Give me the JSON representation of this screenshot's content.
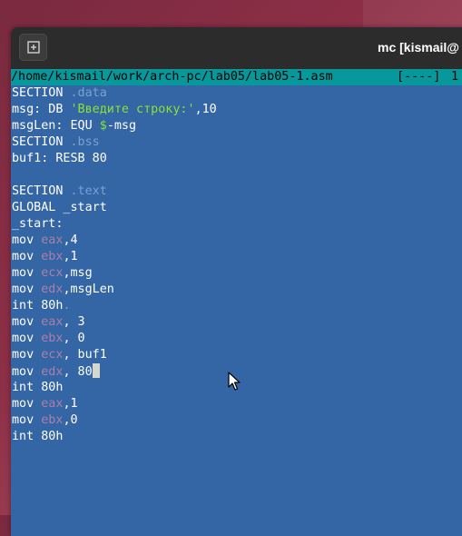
{
  "window": {
    "title": "mc [kismail@"
  },
  "statusbar": {
    "path": "/home/kismail/work/arch-pc/lab05/lab05-1.asm",
    "flags": "[----]",
    "col": "1"
  },
  "code": {
    "l1_kw": "SECTION ",
    "l1_sec": ".data",
    "l2_a": "msg: DB ",
    "l2_str": "'Введите строку:'",
    "l2_b": ",10",
    "l3_a": "msgLen: EQU ",
    "l3_dollar": "$",
    "l3_b": "-msg",
    "l4_kw": "SECTION ",
    "l4_sec": ".bss",
    "l5": "buf1: RESB 80",
    "l7_kw": "SECTION ",
    "l7_sec": ".text",
    "l8": "GLOBAL _start",
    "l9": "_start:",
    "l10_op": "mov ",
    "l10_reg": "eax",
    "l10_arg": ",4",
    "l11_op": "mov ",
    "l11_reg": "ebx",
    "l11_arg": ",1",
    "l12_op": "mov ",
    "l12_reg": "ecx",
    "l12_arg": ",msg",
    "l13_op": "mov ",
    "l13_reg": "edx",
    "l13_arg": ",msgLen",
    "l14": "int 80h",
    "l14_dot": ".",
    "l15_op": "mov ",
    "l15_reg": "eax",
    "l15_arg": ", 3",
    "l16_op": "mov ",
    "l16_reg": "ebx",
    "l16_arg": ", 0",
    "l17_op": "mov ",
    "l17_reg": "ecx",
    "l17_arg": ", buf1",
    "l18_op": "mov ",
    "l18_reg": "edx",
    "l18_arg": ", 80",
    "l19": "int 80h",
    "l20_op": "mov ",
    "l20_reg": "eax",
    "l20_arg": ",1",
    "l21_op": "mov ",
    "l21_reg": "ebx",
    "l21_arg": ",0",
    "l22": "int 80h"
  },
  "colors": {
    "editor_bg": "#3465a4",
    "statusbar_bg": "#06989a",
    "register": "#ad7fa8",
    "string": "#8ae234",
    "section_name": "#7aa1d2"
  },
  "icons": {
    "new_tab": "plus-in-box-icon",
    "mouse": "mouse-pointer-icon"
  }
}
